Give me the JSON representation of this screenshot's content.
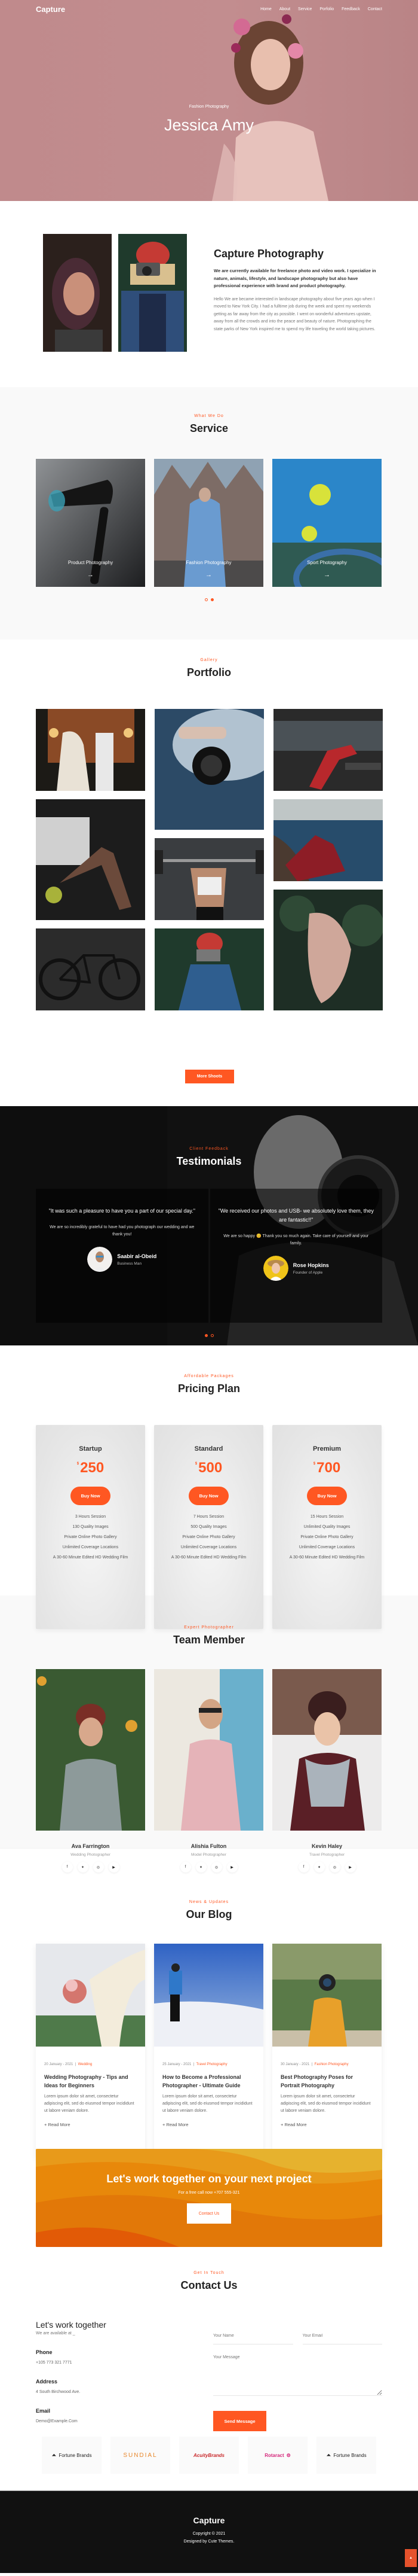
{
  "colors": {
    "accent": "#ff5722",
    "hero_bg": "#c08a8c",
    "footer_bg": "#111111"
  },
  "nav": {
    "logo": "Capture",
    "items": [
      "Home",
      "About",
      "Service",
      "Porfolio",
      "Feedback",
      "Contact"
    ]
  },
  "hero": {
    "subtitle": "Fashion Photography",
    "title": "Jessica Amy"
  },
  "about": {
    "title": "Capture Photography",
    "lead": "We are currently available for freelance photo and video work. I specialize in nature, animals, lifestyle, and landscape photography but also have professional experience with brand and product photography.",
    "body": "Hello We are became interested in landscape photography about five years ago when I moved to New York City. I had a fulltime job during the week and spent my weekends getting as far away from the city as possible. I went on wonderful adventures upstate, away from all the crowds and into the peace and beauty of nature. Photographing the state parks of New York inspired me to spend my life traveling the world taking pictures."
  },
  "service": {
    "subtitle": "What We Do",
    "title": "Service",
    "cards": [
      {
        "label": "Product Photography",
        "icon": "arrow-right-icon"
      },
      {
        "label": "Fashion Photography",
        "icon": "arrow-right-icon"
      },
      {
        "label": "Sport Photography",
        "icon": "arrow-right-icon"
      }
    ],
    "active_dot": 2
  },
  "portfolio": {
    "subtitle": "Gallery",
    "title": "Portfolio",
    "button": "More Shoots",
    "images": [
      "wedding-couple-van",
      "camera-in-smoke",
      "gym-woman-bench",
      "gym-woman-kettlebells",
      "barbell-lift",
      "woman-red-dress-sea",
      "black-bicycle",
      "woman-red-beanie-camera",
      "hands-in-leaves"
    ]
  },
  "testimonials": {
    "subtitle": "Client Feedback",
    "title": "Testimonials",
    "items": [
      {
        "quote": "\"It was such a pleasure to have you a part of our special day.\"",
        "body": "We are so incredibly grateful to have had you photograph our wedding and we thank you!",
        "name": "Saabir al-Obeid",
        "role": "Business Man"
      },
      {
        "quote": "\"We received our photos and USB- we absolutely love them, they are fantastic!!\"",
        "body": "We are so happy 😊 Thank you so much again. Take care of yourself and your family.",
        "name": "Rose Hopkins",
        "role": "Founder of Apple"
      }
    ],
    "active_dot": 1
  },
  "pricing": {
    "subtitle": "Affordable Packages",
    "title": "Pricing Plan",
    "currency": "$",
    "button": "Buy Now",
    "plans": [
      {
        "name": "Startup",
        "price": "250",
        "features": [
          "3 Hours Session",
          "130 Quality Images",
          "Private Online Photo Gallery",
          "Unlimited Coverage Locations",
          "A 30-60 Minute Edited HD Wedding Film"
        ]
      },
      {
        "name": "Standard",
        "price": "500",
        "features": [
          "7 Hours Session",
          "500 Quality Images",
          "Private Online Photo Gallery",
          "Unlimited Coverage Locations",
          "A 30-60 Minute Edited HD Wedding Film"
        ]
      },
      {
        "name": "Premium",
        "price": "700",
        "features": [
          "15 Hours Session",
          "Unlimited Quality Images",
          "Private Online Photo Gallery",
          "Unlimited Coverage Locations",
          "A 30-60 Minute Edited HD Wedding Film"
        ]
      }
    ]
  },
  "team": {
    "subtitle": "Expert Photographer",
    "title": "Team Member",
    "members": [
      {
        "name": "Ava Farrington",
        "role": "Wedding Photographer"
      },
      {
        "name": "Alishia Fulton",
        "role": "Model Photographer"
      },
      {
        "name": "Kevin Haley",
        "role": "Travel Photographer"
      }
    ],
    "socials": [
      {
        "icon": "facebook-icon",
        "glyph": "f"
      },
      {
        "icon": "twitter-icon",
        "glyph": "🐦"
      },
      {
        "icon": "instagram-icon",
        "glyph": "◎"
      },
      {
        "icon": "youtube-icon",
        "glyph": "▶"
      }
    ]
  },
  "blog": {
    "subtitle": "News & Updates",
    "title": "Our Blog",
    "read_more": "+ Read More",
    "posts": [
      {
        "date": "20 January - 2021",
        "category": "Wedding",
        "title": "Wedding Photography - Tips and Ideas for Beginners",
        "excerpt": "Lorem ipsum dolor sit amet, consectetur adipiscing elit, sed do eiusmod tempor incididunt ut labore veniam dolore."
      },
      {
        "date": "25 January - 2021",
        "category": "Travel Photography",
        "title": "How to Become a Professional Photographer - Ultimate Guide",
        "excerpt": "Lorem ipsum dolor sit amet, consectetur adipiscing elit, sed do eiusmod tempor incididunt ut labore veniam dolore."
      },
      {
        "date": "30 January - 2021",
        "category": "Fashion Photography",
        "title": "Best Photography Poses for Portrait Photography",
        "excerpt": "Lorem ipsum dolor sit amet, consectetur adipiscing elit, sed do eiusmod tempor incididunt ut labore veniam dolore."
      }
    ]
  },
  "cta": {
    "title": "Let's work together on your next project",
    "text": "For a free call now +707 555-321",
    "button": "Contact Us"
  },
  "contact": {
    "subtitle": "Get In Touch",
    "title": "Contact Us",
    "heading": "Let's work together",
    "available": "We are available at _",
    "phone_label": "Phone",
    "phone": "+105 773 321 7771",
    "address_label": "Address",
    "address": "4 South Birchwood Ave.",
    "email_label": "Email",
    "email": "Demo@Example.Com",
    "form": {
      "name_placeholder": "Your Name",
      "email_placeholder": "Your Email",
      "message_placeholder": "Your Message",
      "name_value": "",
      "email_value": "",
      "message_value": "",
      "submit": "Send Message"
    }
  },
  "brands": [
    "Fortune Brands",
    "SUNDIAL",
    "AcuityBrands",
    "Rotaract",
    "Fortune Brands"
  ],
  "footer": {
    "logo": "Capture",
    "copyright": "Copyright © 2021",
    "credit": "Designed by Cute Themes.",
    "to_top_icon": "arrow-up-icon"
  }
}
